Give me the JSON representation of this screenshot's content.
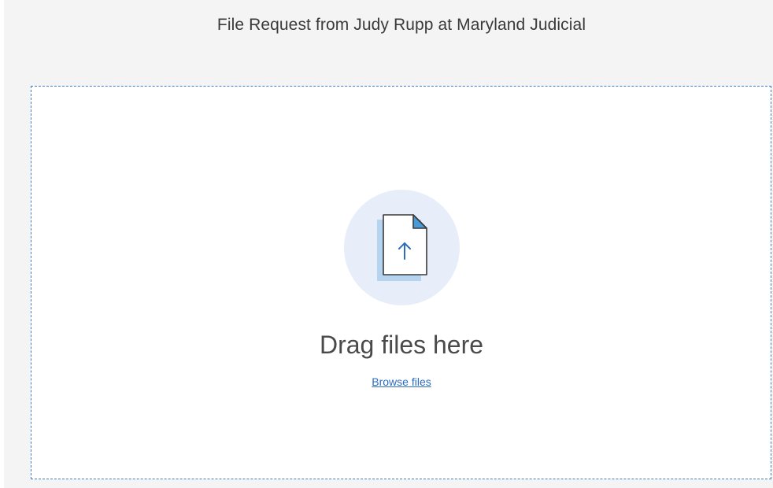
{
  "header": {
    "title": "File Request from Judy Rupp at Maryland Judicial"
  },
  "dropzone": {
    "icon": "file-upload-icon",
    "drag_text": "Drag files here",
    "browse_label": "Browse files"
  },
  "colors": {
    "accent": "#2d6cbf",
    "dropzone_border": "#3f7ec0",
    "icon_circle": "#e7eef9",
    "icon_shadow": "#b5d4f0",
    "icon_corner": "#4a9ad8",
    "background": "#f4f4f4"
  }
}
